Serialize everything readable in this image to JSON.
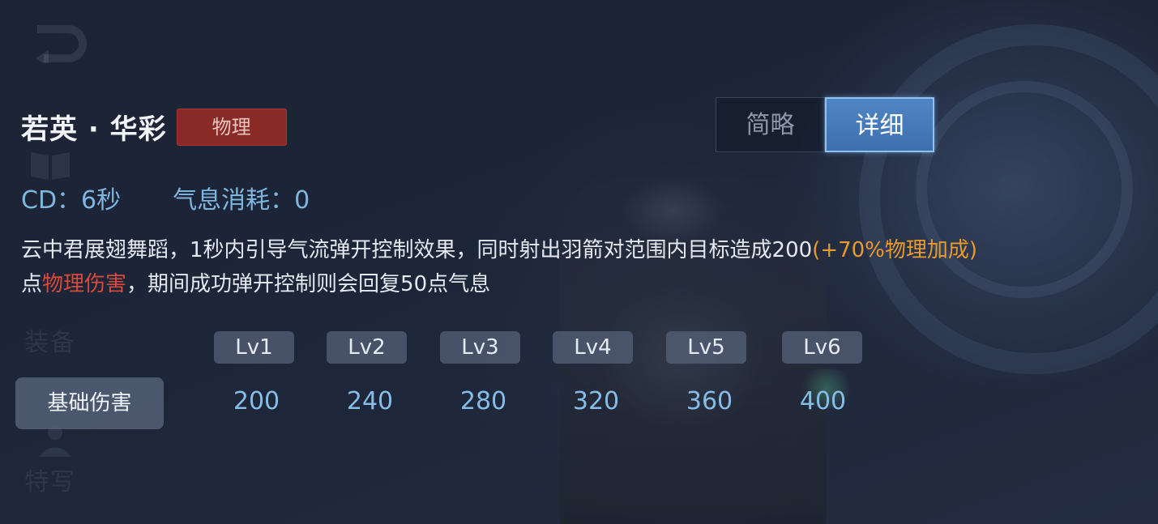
{
  "background_ghost_text": {
    "nav_item_1": "装备",
    "nav_item_2": "特写"
  },
  "skill": {
    "name": "若英 · 华彩",
    "damage_type": "物理"
  },
  "view_toggle": {
    "brief_label": "简略",
    "detail_label": "详细",
    "selected": "详细"
  },
  "stats": {
    "cooldown": "CD：6秒",
    "cost": "气息消耗：0"
  },
  "description": {
    "part1": "云中君展翅舞蹈，1秒内引导气流弹开控制效果，同时射出羽箭对范围内目标造成200",
    "bonus": "(+70%物理加成)",
    "part2": "点",
    "damage_kind": "物理伤害",
    "part3": "，期间成功弹开控制则会回复50点气息"
  },
  "levels": {
    "headers": [
      "Lv1",
      "Lv2",
      "Lv3",
      "Lv4",
      "Lv5",
      "Lv6"
    ],
    "row_label": "基础伤害",
    "base_damage": [
      "200",
      "240",
      "280",
      "320",
      "360",
      "400"
    ]
  },
  "colors": {
    "physical_badge": "#8a2a26",
    "bonus_text": "#e89a2c",
    "physical_damage_text": "#d94a3a",
    "stat_text": "#7fb6e0",
    "active_toggle": "#4f86c6"
  }
}
